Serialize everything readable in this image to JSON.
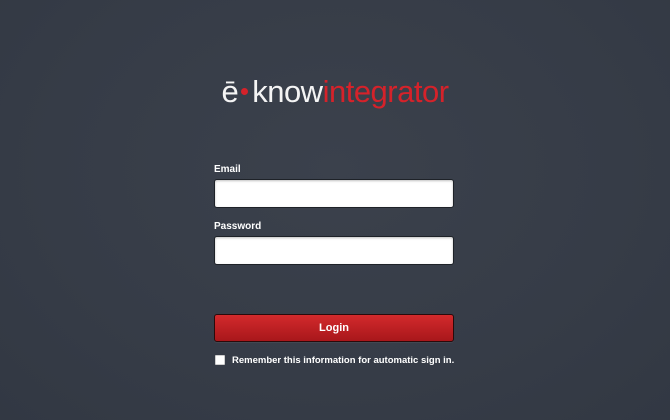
{
  "logo": {
    "part1": "ē",
    "part2": "know",
    "part3": "integrator"
  },
  "form": {
    "email_label": "Email",
    "email_value": "",
    "password_label": "Password",
    "password_value": "",
    "login_label": "Login",
    "remember_label": "Remember this information for automatic sign in.",
    "remember_checked": false
  },
  "colors": {
    "background": "#373d48",
    "accent": "#d5222a",
    "button_top": "#d32a2c",
    "button_bottom": "#a8171b"
  }
}
